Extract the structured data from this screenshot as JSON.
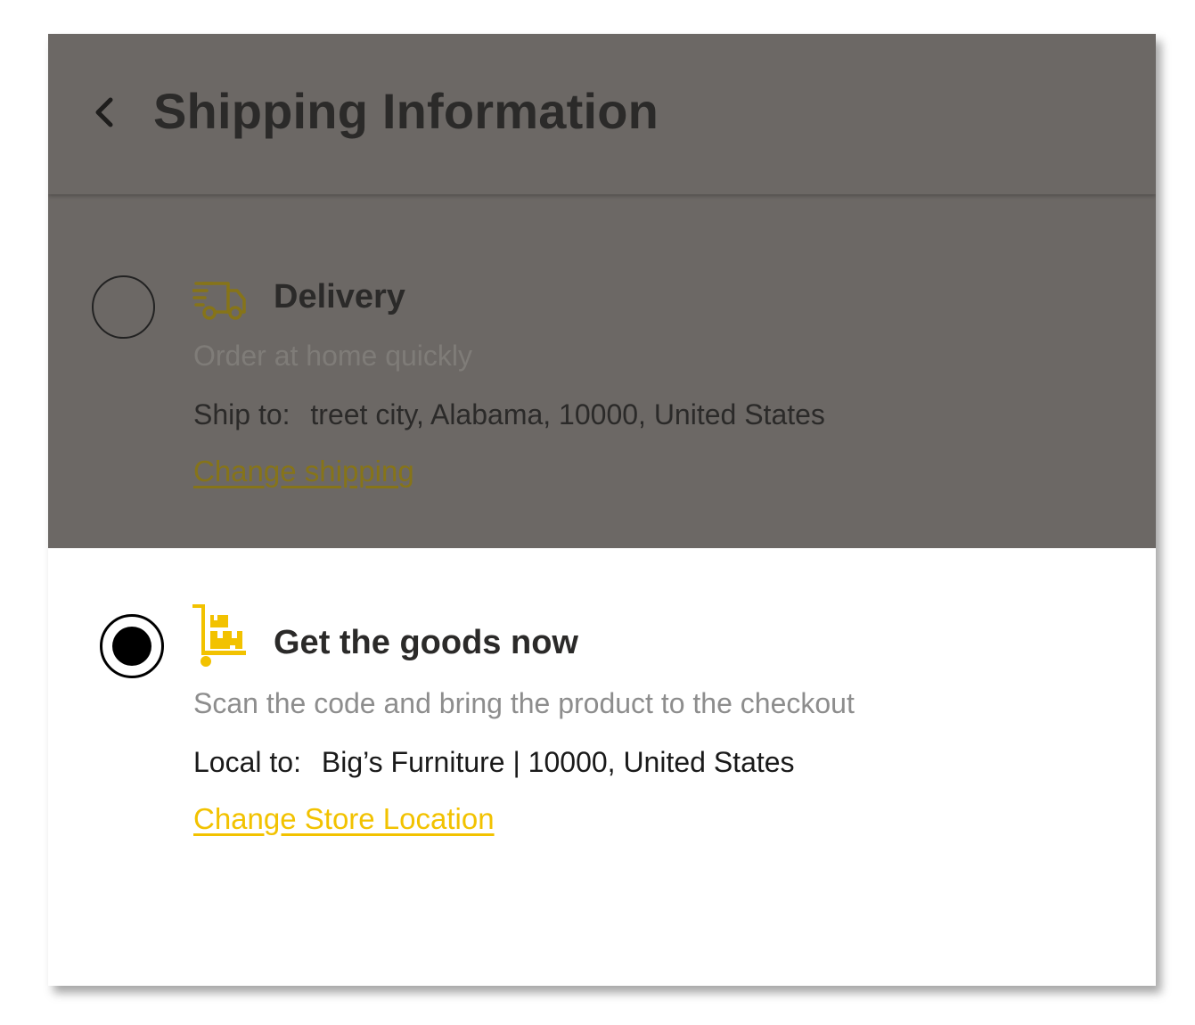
{
  "header": {
    "title": "Shipping Information",
    "back_icon": "chevron-left-icon"
  },
  "options": {
    "delivery": {
      "selected": false,
      "icon": "delivery-truck-icon",
      "title": "Delivery",
      "subtitle": "Order at home quickly",
      "address_label": "Ship to:",
      "address_value": "treet city, Alabama, 10000, United States",
      "link": "Change shipping"
    },
    "pickup": {
      "selected": true,
      "icon": "hand-truck-icon",
      "title": "Get the goods now",
      "subtitle": "Scan the code and bring the product to the checkout",
      "address_label": "Local to:",
      "address_value": "Big’s Furniture | 10000, United States",
      "link": "Change Store Location"
    }
  },
  "colors": {
    "overlay": "#6c6865",
    "accent": "#f2c200",
    "accent_dimmed": "#867419",
    "text_dark": "#2b2a29",
    "text_muted": "#8d8d8d"
  }
}
